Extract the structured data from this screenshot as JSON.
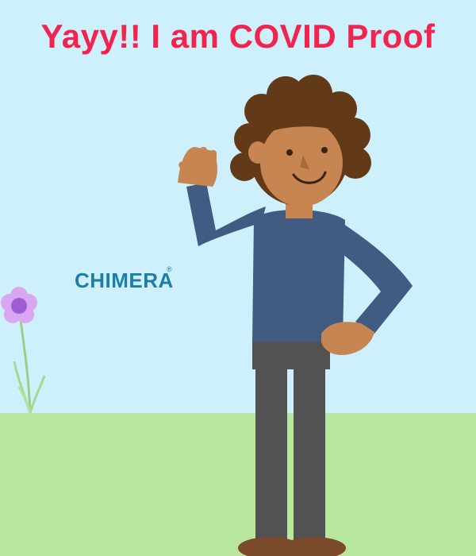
{
  "headline": "Yayy!! I am COVID Proof",
  "logo": {
    "text": "CHIMERA",
    "mark": "®"
  },
  "colors": {
    "sky": "#cdf0fc",
    "ground": "#b9e79e",
    "headline": "#f0244e",
    "logo": "#1e7fa6",
    "shirt": "#425b83",
    "pants": "#525252",
    "skin": "#c78651",
    "hair": "#623a17",
    "flower": "#a05bd6"
  },
  "icons": [
    "flower-illustration",
    "waving-person-illustration",
    "chimera-logo"
  ]
}
